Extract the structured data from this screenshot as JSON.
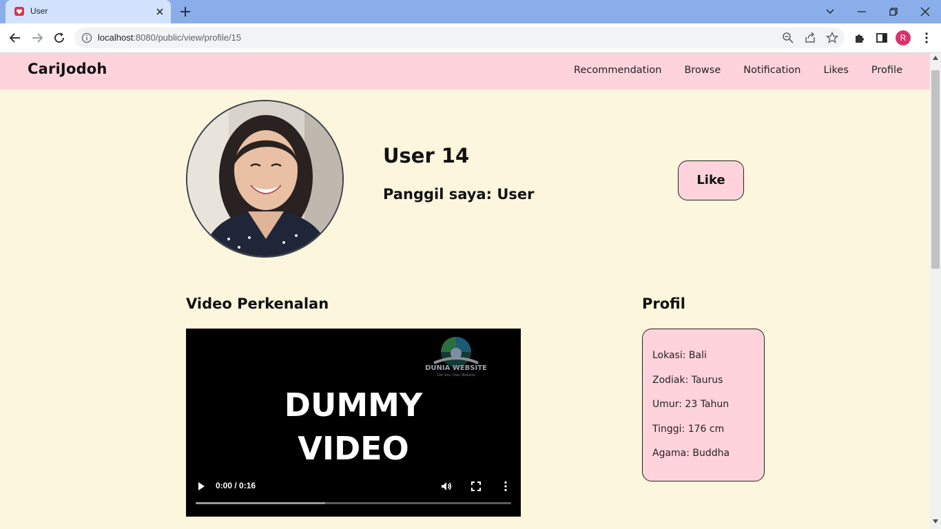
{
  "browser": {
    "tab_title": "User",
    "url_host": "localhost",
    "url_rest": ":8080/public/view/profile/15",
    "avatar_letter": "R",
    "icons": [
      "heart-favicon-icon",
      "close-icon",
      "plus-icon",
      "chevron-down-icon",
      "minimize-icon",
      "restore-icon",
      "window-close-icon",
      "back-arrow-icon",
      "forward-arrow-icon",
      "reload-icon",
      "info-icon",
      "zoom-icon",
      "share-icon",
      "star-icon",
      "extensions-icon",
      "sidebar-icon",
      "kebab-menu-icon"
    ]
  },
  "navbar": {
    "brand": "CariJodoh",
    "links": [
      "Recommendation",
      "Browse",
      "Notification",
      "Likes",
      "Profile"
    ]
  },
  "profile": {
    "name": "User 14",
    "nickname": "Panggil saya: User",
    "like_label": "Like"
  },
  "video_section": {
    "title": "Video Perkenalan",
    "watermark_title": "DUNIA WEBSITE",
    "watermark_subtitle": "Get Your Own Website",
    "caption_line1": "DUMMY",
    "caption_line2": "VIDEO",
    "time": "0:00 / 0:16",
    "buffered_fraction": 0.41
  },
  "info_section": {
    "title": "Profil",
    "lines": [
      "Lokasi: Bali",
      "Zodiak: Taurus",
      "Umur: 23 Tahun",
      "Tinggi: 176 cm",
      "Agama: Buddha"
    ]
  },
  "colors": {
    "navbar_bg": "#ffd3dc",
    "page_bg": "#fbf6dc",
    "tabstrip_bg": "#8aaee9",
    "accent_pink": "#ffd3dc"
  }
}
